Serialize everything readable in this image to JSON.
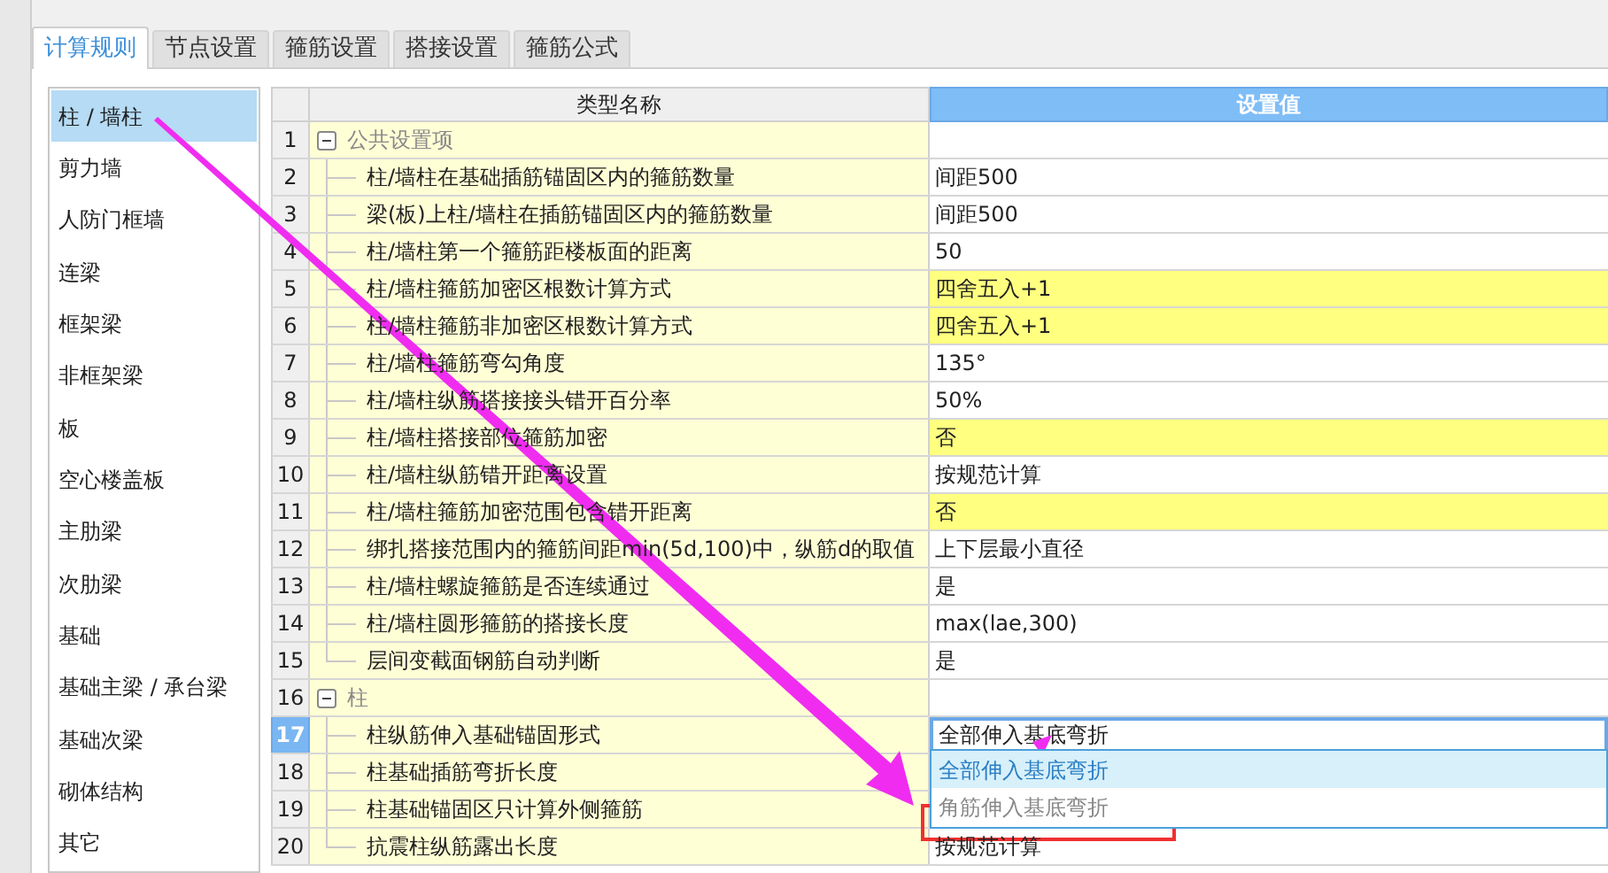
{
  "tabs": [
    {
      "label": "计算规则",
      "selected": true
    },
    {
      "label": "节点设置",
      "selected": false
    },
    {
      "label": "箍筋设置",
      "selected": false
    },
    {
      "label": "搭接设置",
      "selected": false
    },
    {
      "label": "箍筋公式",
      "selected": false
    }
  ],
  "sidebar": {
    "items": [
      {
        "label": "柱 / 墙柱",
        "selected": true
      },
      {
        "label": "剪力墙",
        "selected": false
      },
      {
        "label": "人防门框墙",
        "selected": false
      },
      {
        "label": "连梁",
        "selected": false
      },
      {
        "label": "框架梁",
        "selected": false
      },
      {
        "label": "非框架梁",
        "selected": false
      },
      {
        "label": "板",
        "selected": false
      },
      {
        "label": "空心楼盖板",
        "selected": false
      },
      {
        "label": "主肋梁",
        "selected": false
      },
      {
        "label": "次肋梁",
        "selected": false
      },
      {
        "label": "基础",
        "selected": false
      },
      {
        "label": "基础主梁 / 承台梁",
        "selected": false
      },
      {
        "label": "基础次梁",
        "selected": false
      },
      {
        "label": "砌体结构",
        "selected": false
      },
      {
        "label": "其它",
        "selected": false
      }
    ]
  },
  "table": {
    "columns": [
      "类型名称",
      "设置值"
    ],
    "rows": [
      {
        "number": "1",
        "name": "公共设置项",
        "expanded": true,
        "selected": false,
        "children": [
          {
            "number": "2",
            "name": "柱/墙柱在基础插筋锚固区内的箍筋数量",
            "value": "间距500",
            "highlighted": false,
            "selected": false
          },
          {
            "number": "3",
            "name": "梁(板)上柱/墙柱在插筋锚固区内的箍筋数量",
            "value": "间距500",
            "highlighted": false,
            "selected": false
          },
          {
            "number": "4",
            "name": "柱/墙柱第一个箍筋距楼板面的距离",
            "value": "50",
            "highlighted": false,
            "selected": false
          },
          {
            "number": "5",
            "name": "柱/墙柱箍筋加密区根数计算方式",
            "value": "四舍五入+1",
            "highlighted": true,
            "selected": false
          },
          {
            "number": "6",
            "name": "柱/墙柱箍筋非加密区根数计算方式",
            "value": "四舍五入+1",
            "highlighted": true,
            "selected": false
          },
          {
            "number": "7",
            "name": "柱/墙柱箍筋弯勾角度",
            "value": "135°",
            "highlighted": false,
            "selected": false
          },
          {
            "number": "8",
            "name": "柱/墙柱纵筋搭接接头错开百分率",
            "value": "50%",
            "highlighted": false,
            "selected": false
          },
          {
            "number": "9",
            "name": "柱/墙柱搭接部位箍筋加密",
            "value": "否",
            "highlighted": true,
            "selected": false
          },
          {
            "number": "10",
            "name": "柱/墙柱纵筋错开距离设置",
            "value": "按规范计算",
            "highlighted": false,
            "selected": false
          },
          {
            "number": "11",
            "name": "柱/墙柱箍筋加密范围包含错开距离",
            "value": "否",
            "highlighted": true,
            "selected": false
          },
          {
            "number": "12",
            "name": "绑扎搭接范围内的箍筋间距min(5d,100)中，纵筋d的取值",
            "value": "上下层最小直径",
            "highlighted": false,
            "selected": false
          },
          {
            "number": "13",
            "name": "柱/墙柱螺旋箍筋是否连续通过",
            "value": "是",
            "highlighted": false,
            "selected": false
          },
          {
            "number": "14",
            "name": "柱/墙柱圆形箍筋的搭接长度",
            "value": "max(lae,300)",
            "highlighted": false,
            "selected": false
          },
          {
            "number": "15",
            "name": "层间变截面钢筋自动判断",
            "value": "是",
            "highlighted": false,
            "selected": false
          }
        ]
      },
      {
        "number": "16",
        "name": "柱",
        "expanded": true,
        "selected": false,
        "children": [
          {
            "number": "17",
            "name": "柱纵筋伸入基础锚固形式",
            "value": "全部伸入基底弯折",
            "highlighted": false,
            "selected": true
          },
          {
            "number": "18",
            "name": "柱基础插筋弯折长度",
            "selected": false
          },
          {
            "number": "19",
            "name": "柱基础锚固区只计算外侧箍筋",
            "selected": false
          },
          {
            "number": "20",
            "name": "抗震柱纵筋露出长度",
            "value": "按规范计算",
            "highlighted": false,
            "selected": false
          }
        ]
      }
    ],
    "dropdown": {
      "options": [
        {
          "label": "全部伸入基底弯折",
          "selected": true
        },
        {
          "label": "角筋伸入基底弯折",
          "selected": false
        }
      ]
    }
  },
  "annotations": [
    {
      "kind": "arrow"
    },
    {
      "kind": "arrow"
    },
    {
      "kind": "box"
    }
  ]
}
